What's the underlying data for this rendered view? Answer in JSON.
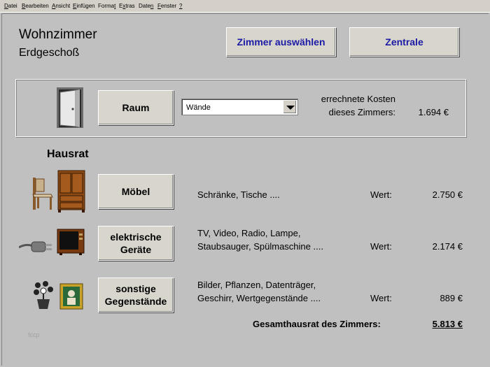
{
  "menu": [
    {
      "accel": "D",
      "rest": "atei"
    },
    {
      "accel": "B",
      "rest": "earbeiten"
    },
    {
      "accel": "A",
      "rest": "nsicht"
    },
    {
      "accel": "E",
      "rest": "infügen"
    },
    {
      "accel": "",
      "pre": "Forma",
      "rest": "t"
    },
    {
      "accel": "",
      "pre": "E",
      "rest": "xtras"
    },
    {
      "accel": "",
      "pre": "Date",
      "rest": "n"
    },
    {
      "accel": "F",
      "rest": "enster"
    },
    {
      "accel": "?",
      "rest": ""
    }
  ],
  "header": {
    "room": "Wohnzimmer",
    "floor": "Erdgeschoß",
    "btn_select_room": "Zimmer auswählen",
    "btn_central": "Zentrale"
  },
  "raum": {
    "button": "Raum",
    "select_value": "Wände",
    "cost_label_line1": "errechnete Kosten",
    "cost_label_line2": "dieses Zimmers:",
    "cost_value": "1.694 €"
  },
  "hausrat": {
    "heading": "Hausrat",
    "items": [
      {
        "button_line1": "Möbel",
        "button_line2": "",
        "desc_line1": "Schränke, Tische ....",
        "desc_line2": "",
        "wert_label": "Wert:",
        "value": "2.750 €"
      },
      {
        "button_line1": "elektrische",
        "button_line2": "Geräte",
        "desc_line1": "TV, Video, Radio, Lampe,",
        "desc_line2": "Staubsauger, Spülmaschine ....",
        "wert_label": "Wert:",
        "value": "2.174 €"
      },
      {
        "button_line1": "sonstige",
        "button_line2": "Gegenstände",
        "desc_line1": "Bilder, Pflanzen, Datenträger,",
        "desc_line2": "Geschirr, Wertgegenstände ....",
        "wert_label": "Wert:",
        "value": "889 €"
      }
    ],
    "total_label": "Gesamthausrat des Zimmers:",
    "total_value": "5.813 €"
  },
  "footer_text": "fccp"
}
